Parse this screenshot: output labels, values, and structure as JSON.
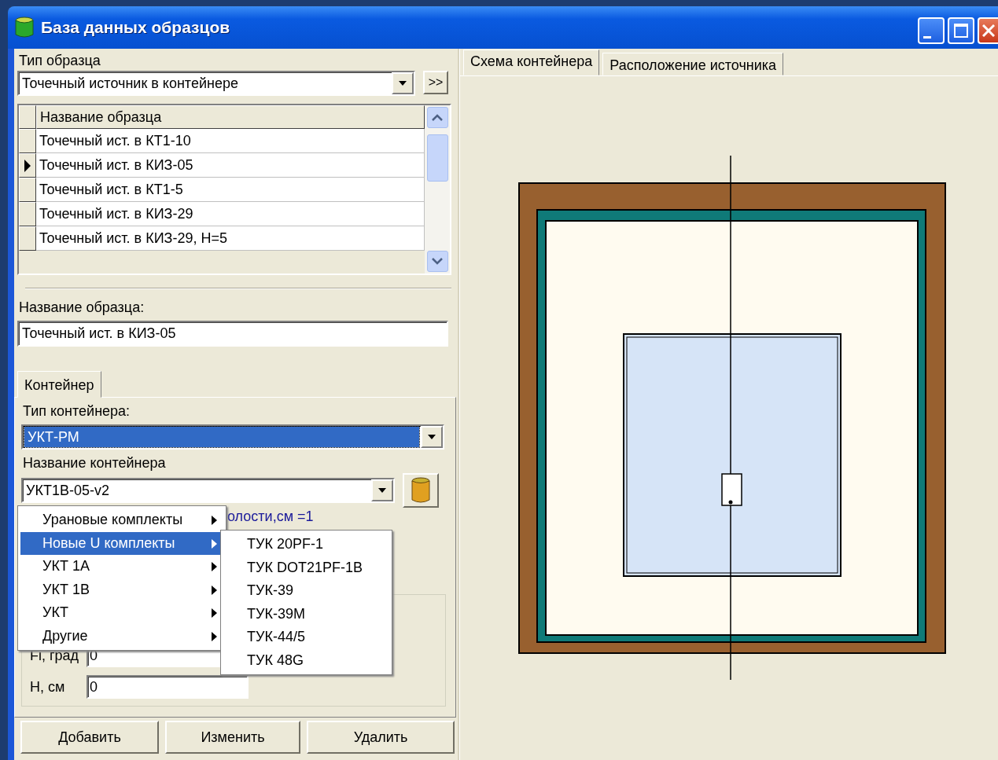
{
  "window": {
    "title": "База данных образцов"
  },
  "sample_type": {
    "label": "Тип образца",
    "value": "Точечный источник в контейнере",
    "more_button": ">>"
  },
  "samples_table": {
    "column": "Название образца",
    "rows": [
      {
        "name": "Точечный ист. в КТ1-10",
        "selected": false
      },
      {
        "name": "Точечный ист. в КИЗ-05",
        "selected": true
      },
      {
        "name": "Точечный ист. в КТ1-5",
        "selected": false
      },
      {
        "name": "Точечный ист. в КИЗ-29",
        "selected": false
      },
      {
        "name": "Точечный ист. в КИЗ-29, H=5",
        "selected": false
      }
    ]
  },
  "sample_name": {
    "label": "Название образца:",
    "value": "Точечный ист. в КИЗ-05"
  },
  "container_tabs": [
    {
      "label": "Контейнер",
      "selected": true
    }
  ],
  "container_type": {
    "label": "Тип контейнера:",
    "value": "УКТ-РМ"
  },
  "container_name": {
    "label": "Название контейнера",
    "value": "УКТ1В-05-v2"
  },
  "cavity_text": "олости,см =1",
  "position_fields": [
    {
      "label": "Fi, град",
      "value": "0"
    },
    {
      "label": "H, см",
      "value": "0"
    }
  ],
  "buttons": [
    "Добавить",
    "Изменить",
    "Удалить"
  ],
  "diagram_tabs": [
    {
      "label": "Схема контейнера",
      "selected": true
    },
    {
      "label": "Расположение источника",
      "selected": false
    }
  ],
  "context_menu": {
    "items": [
      {
        "label": "Урановые комплекты",
        "selected": false
      },
      {
        "label": "Новые U комплекты",
        "selected": true
      },
      {
        "label": "УКТ 1А",
        "selected": false
      },
      {
        "label": "УКТ 1В",
        "selected": false
      },
      {
        "label": "УКТ",
        "selected": false
      },
      {
        "label": "Другие",
        "selected": false
      }
    ]
  },
  "submenu": {
    "items": [
      "ТУК 20PF-1",
      "ТУК DOT21PF-1B",
      "ТУК-39",
      "ТУК-39M",
      "ТУК-44/5",
      "ТУК 48G"
    ]
  }
}
